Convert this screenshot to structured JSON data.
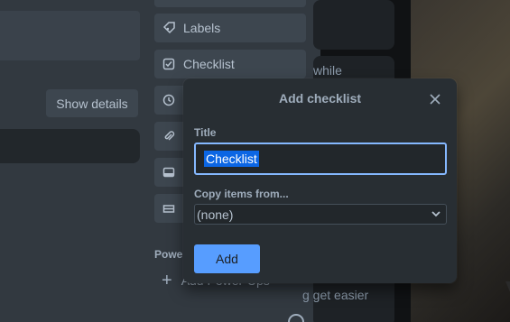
{
  "card_detail": {
    "show_details_label": "Show details"
  },
  "sidebar": {
    "items": [
      {
        "label": "Labels",
        "icon": "label-icon"
      },
      {
        "label": "Checklist",
        "icon": "checklist-icon"
      },
      {
        "label": "",
        "icon": "clock-icon"
      },
      {
        "label": "",
        "icon": "attachment-icon"
      },
      {
        "label": "",
        "icon": "cover-icon"
      },
      {
        "label": "",
        "icon": "custom-fields-icon"
      }
    ],
    "power_ups_label": "Power",
    "add_power_ups_label": "Add Power-Ups"
  },
  "board": {
    "card_text_1": "while",
    "card_text_2": "g get easier"
  },
  "popover": {
    "title": "Add checklist",
    "title_field_label": "Title",
    "title_value": "Checklist",
    "copy_field_label": "Copy items from...",
    "copy_selected": "(none)",
    "add_button": "Add"
  },
  "colors": {
    "accent": "#579dff",
    "selection": "#0c66e4",
    "focus_border": "#85b8ff"
  }
}
